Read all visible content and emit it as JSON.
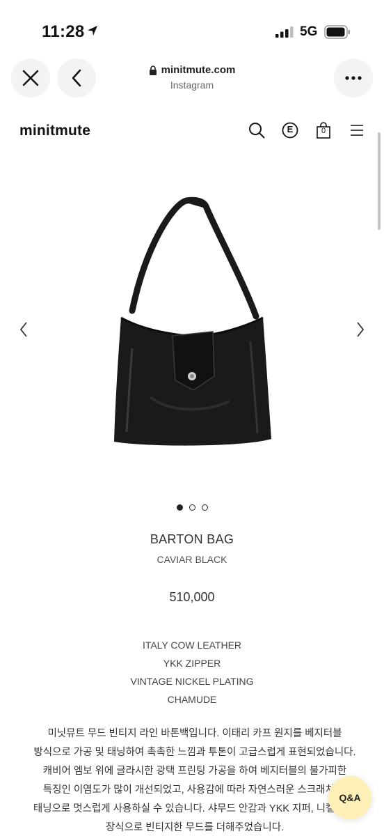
{
  "status_bar": {
    "time": "11:28",
    "network": "5G"
  },
  "browser": {
    "url": "minitmute.com",
    "source": "Instagram"
  },
  "site": {
    "logo": "minitmute",
    "cart_count": "0",
    "e_icon_label": "E"
  },
  "carousel": {
    "slide_count": 3,
    "active_slide": 1
  },
  "product": {
    "name": "BARTON BAG",
    "color": "CAVIAR BLACK",
    "price": "510,000",
    "features": [
      "ITALY COW LEATHER",
      "YKK ZIPPER",
      "VINTAGE NICKEL PLATING",
      "CHAMUDE"
    ],
    "description": "미닛뮤트 무드 빈티지 라인 바톤백입니다. 이태리 카프 원지를 베지터블 방식으로 가공 및 태닝하여 촉촉한 느낌과 투톤이 고급스럽게 표현되었습니다. 캐비어 엠보 위에 글라시한 광택 프린팅 가공을 하여 베지터블의 불가피한 특징인 이염도가 많이 개선되었고, 사용감에 따라 자연스러운 스크래치 및 태닝으로 멋스럽게 사용하실 수 있습니다. 샤무드 안감과 YKK 지퍼, 니켈 가랑 장식으로 빈티지한 무드를 더해주었습니다."
  },
  "qa_button": {
    "label": "Q&A"
  },
  "colors": {
    "qa_bg": "#fff0b8",
    "bag": "#1a1a1a"
  }
}
